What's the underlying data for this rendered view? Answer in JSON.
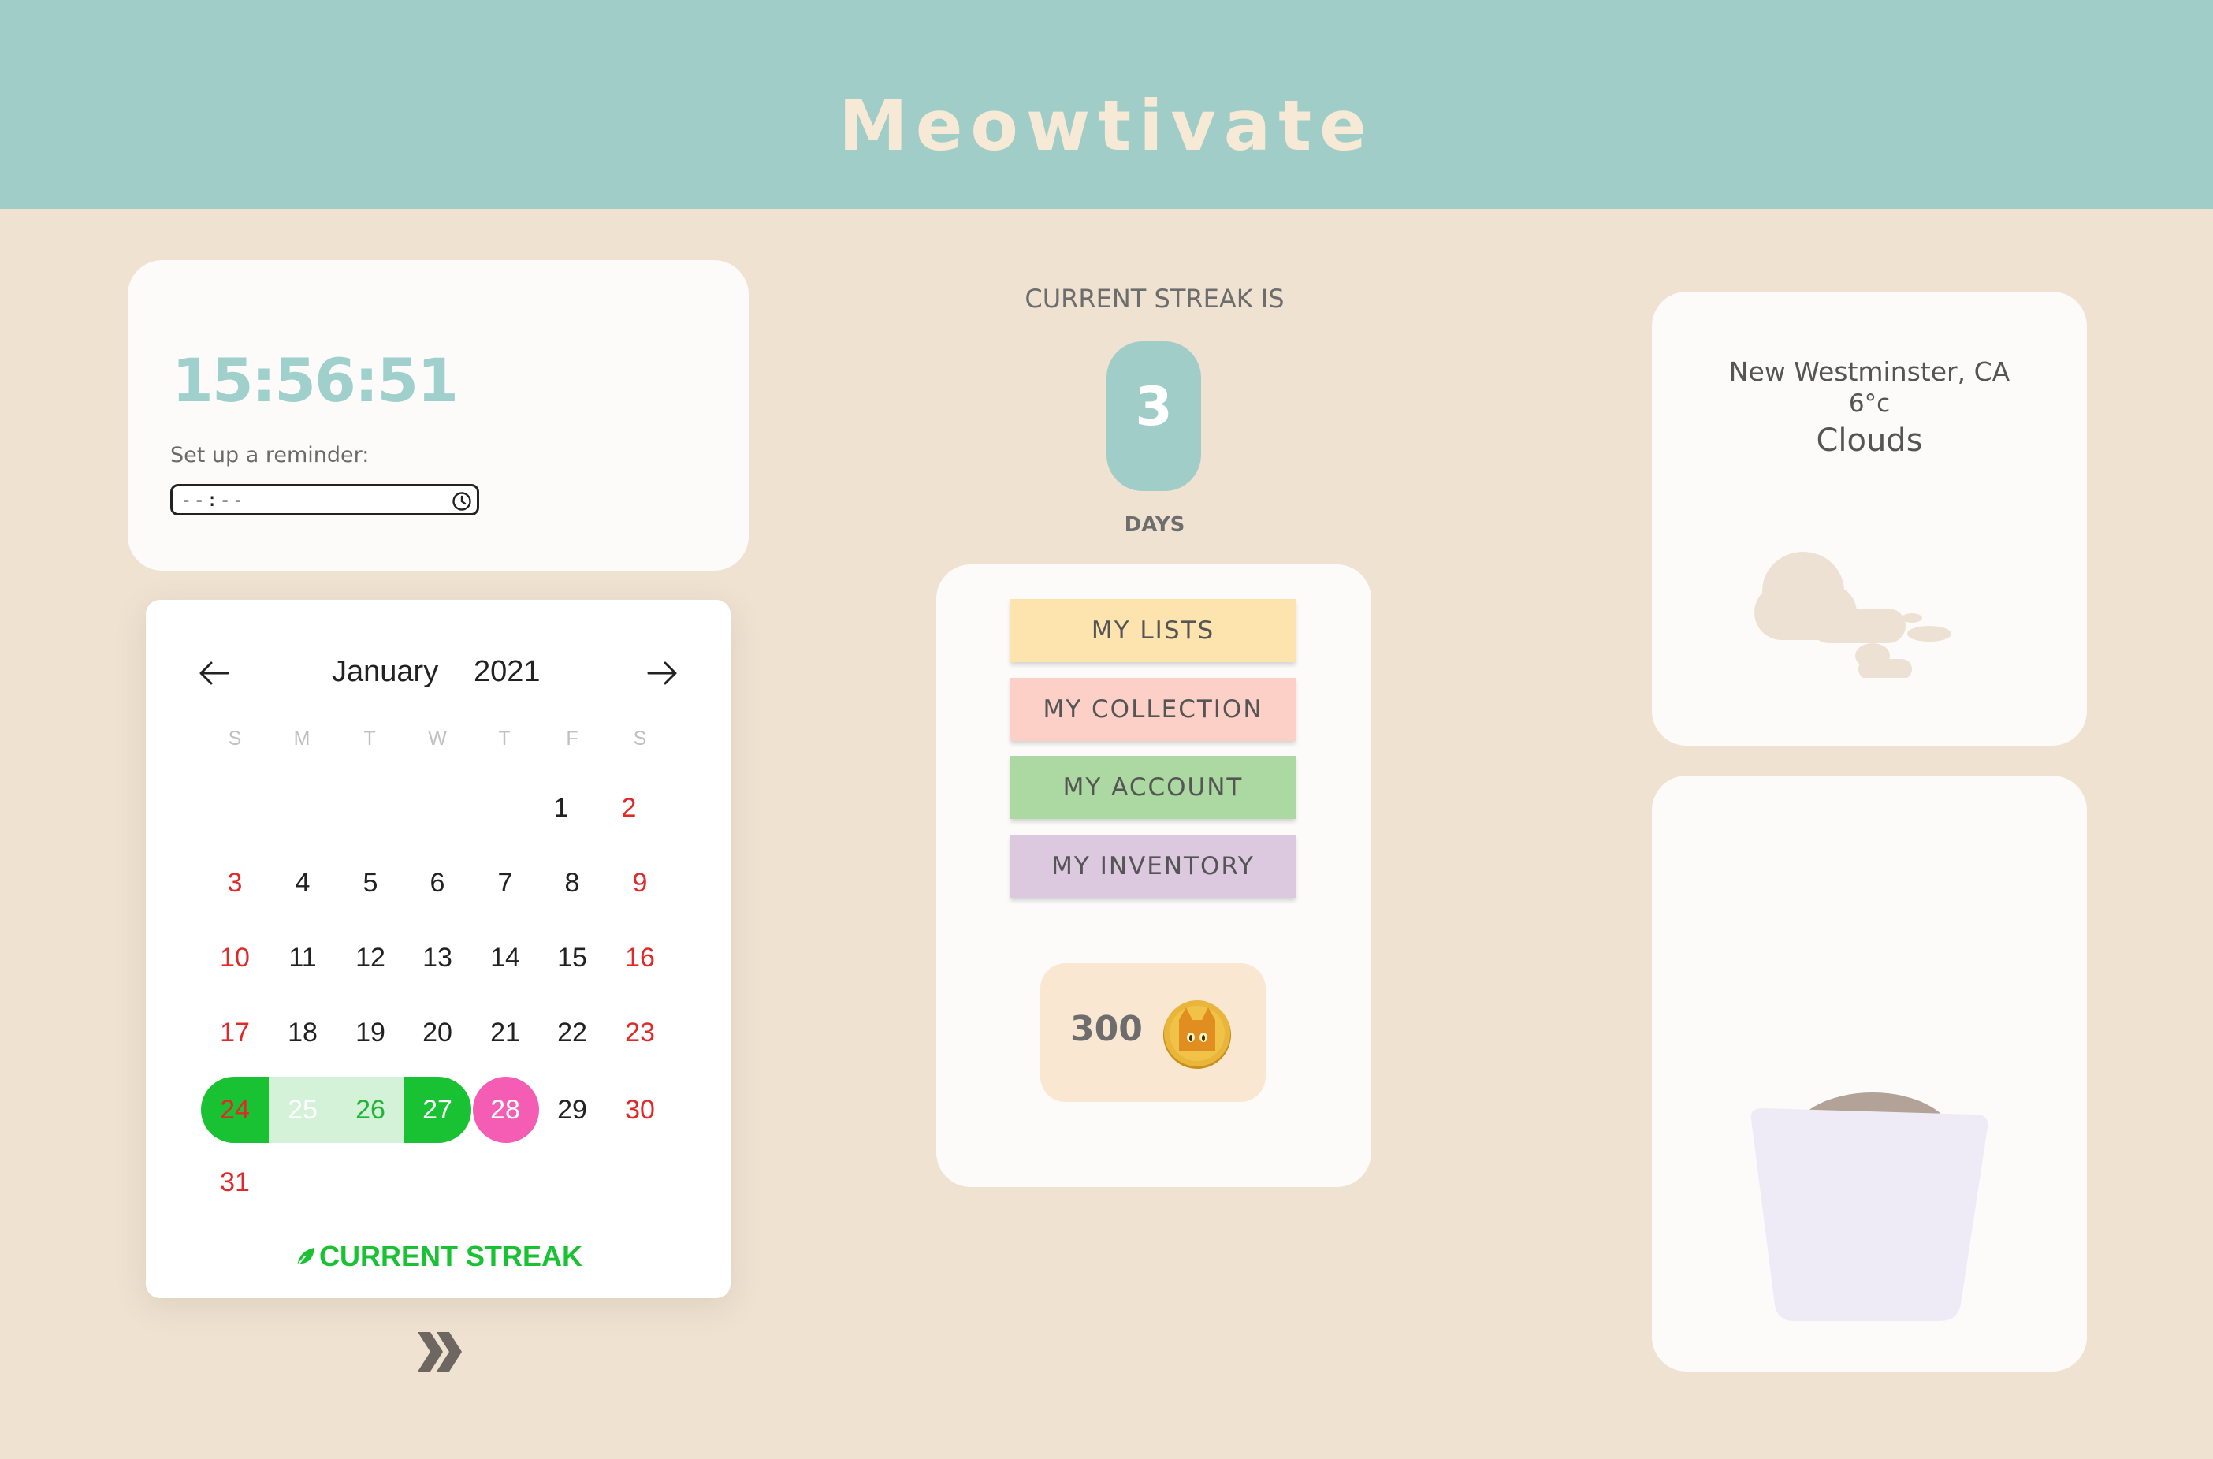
{
  "app": {
    "title": "Meowtivate"
  },
  "clock": {
    "time": "15:56:51",
    "reminder_label": "Set up a reminder:",
    "reminder_value": "--:--"
  },
  "calendar": {
    "month": "January",
    "year": "2021",
    "weekdays": [
      "S",
      "M",
      "T",
      "W",
      "T",
      "F",
      "S"
    ],
    "days": [
      "1",
      "2",
      "3",
      "4",
      "5",
      "6",
      "7",
      "8",
      "9",
      "10",
      "11",
      "12",
      "13",
      "14",
      "15",
      "16",
      "17",
      "18",
      "19",
      "20",
      "21",
      "22",
      "23",
      "24",
      "25",
      "26",
      "27",
      "28",
      "29",
      "30",
      "31"
    ],
    "legend": "CURRENT STREAK",
    "colors": {
      "weekend": "#e02a2a",
      "streak": "#18c232",
      "streak_light": "#d4f2d7",
      "today": "#f45db3"
    }
  },
  "streak": {
    "heading": "CURRENT STREAK IS",
    "count": "3",
    "unit": "DAYS"
  },
  "menu": {
    "buttons": [
      {
        "label": "MY LISTS",
        "color": "#fde3ad"
      },
      {
        "label": "MY COLLECTION",
        "color": "#fcd0c7"
      },
      {
        "label": "MY ACCOUNT",
        "color": "#acd9a1"
      },
      {
        "label": "MY INVENTORY",
        "color": "#dcc8df"
      }
    ],
    "coins": "300",
    "coin_icon": "cat-coin-icon"
  },
  "weather": {
    "location": "New Westminster, CA",
    "temperature": "6°c",
    "condition": "Clouds",
    "icon": "clouds-icon"
  },
  "icons": {
    "prev": "arrow-left-icon",
    "next": "arrow-right-icon",
    "clock": "clock-icon",
    "leaf": "leaf-icon",
    "forward": "double-chevron-right-icon",
    "pet": "cat-in-pot-icon"
  }
}
